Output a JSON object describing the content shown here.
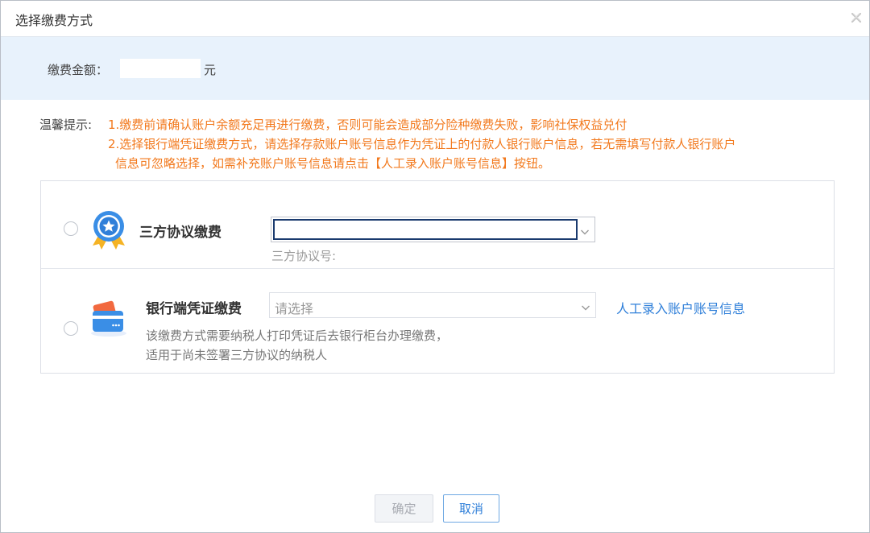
{
  "dialog": {
    "title": "选择缴费方式"
  },
  "amount": {
    "label": "缴费金额：",
    "unit": "元"
  },
  "tip": {
    "label": "温馨提示:",
    "line1": "1.缴费前请确认账户余额充足再进行缴费，否则可能会造成部分险种缴费失败，影响社保权益兑付",
    "line2": "2.选择银行端凭证缴费方式，请选择存款账户账号信息作为凭证上的付款人银行账户信息，若无需填写付款人银行账户",
    "line3": "信息可忽略选择，如需补充账户账号信息请点击【人工录入账户账号信息】按钮。"
  },
  "options": [
    {
      "title": "三方协议缴费",
      "hint": "三方协议号:",
      "icon": "medal-star-icon"
    },
    {
      "title": "银行端凭证缴费",
      "placeholder": "请选择",
      "link": "人工录入账户账号信息",
      "desc1": "该缴费方式需要纳税人打印凭证后去银行柜台办理缴费，",
      "desc2": "适用于尚未签署三方协议的纳税人",
      "icon": "bank-card-icon"
    }
  ],
  "buttons": {
    "ok": "确定",
    "cancel": "取消"
  },
  "colors": {
    "accent": "#2f7fd9",
    "warning_text": "#f2791d",
    "amount_bg": "#e8f2fc"
  }
}
